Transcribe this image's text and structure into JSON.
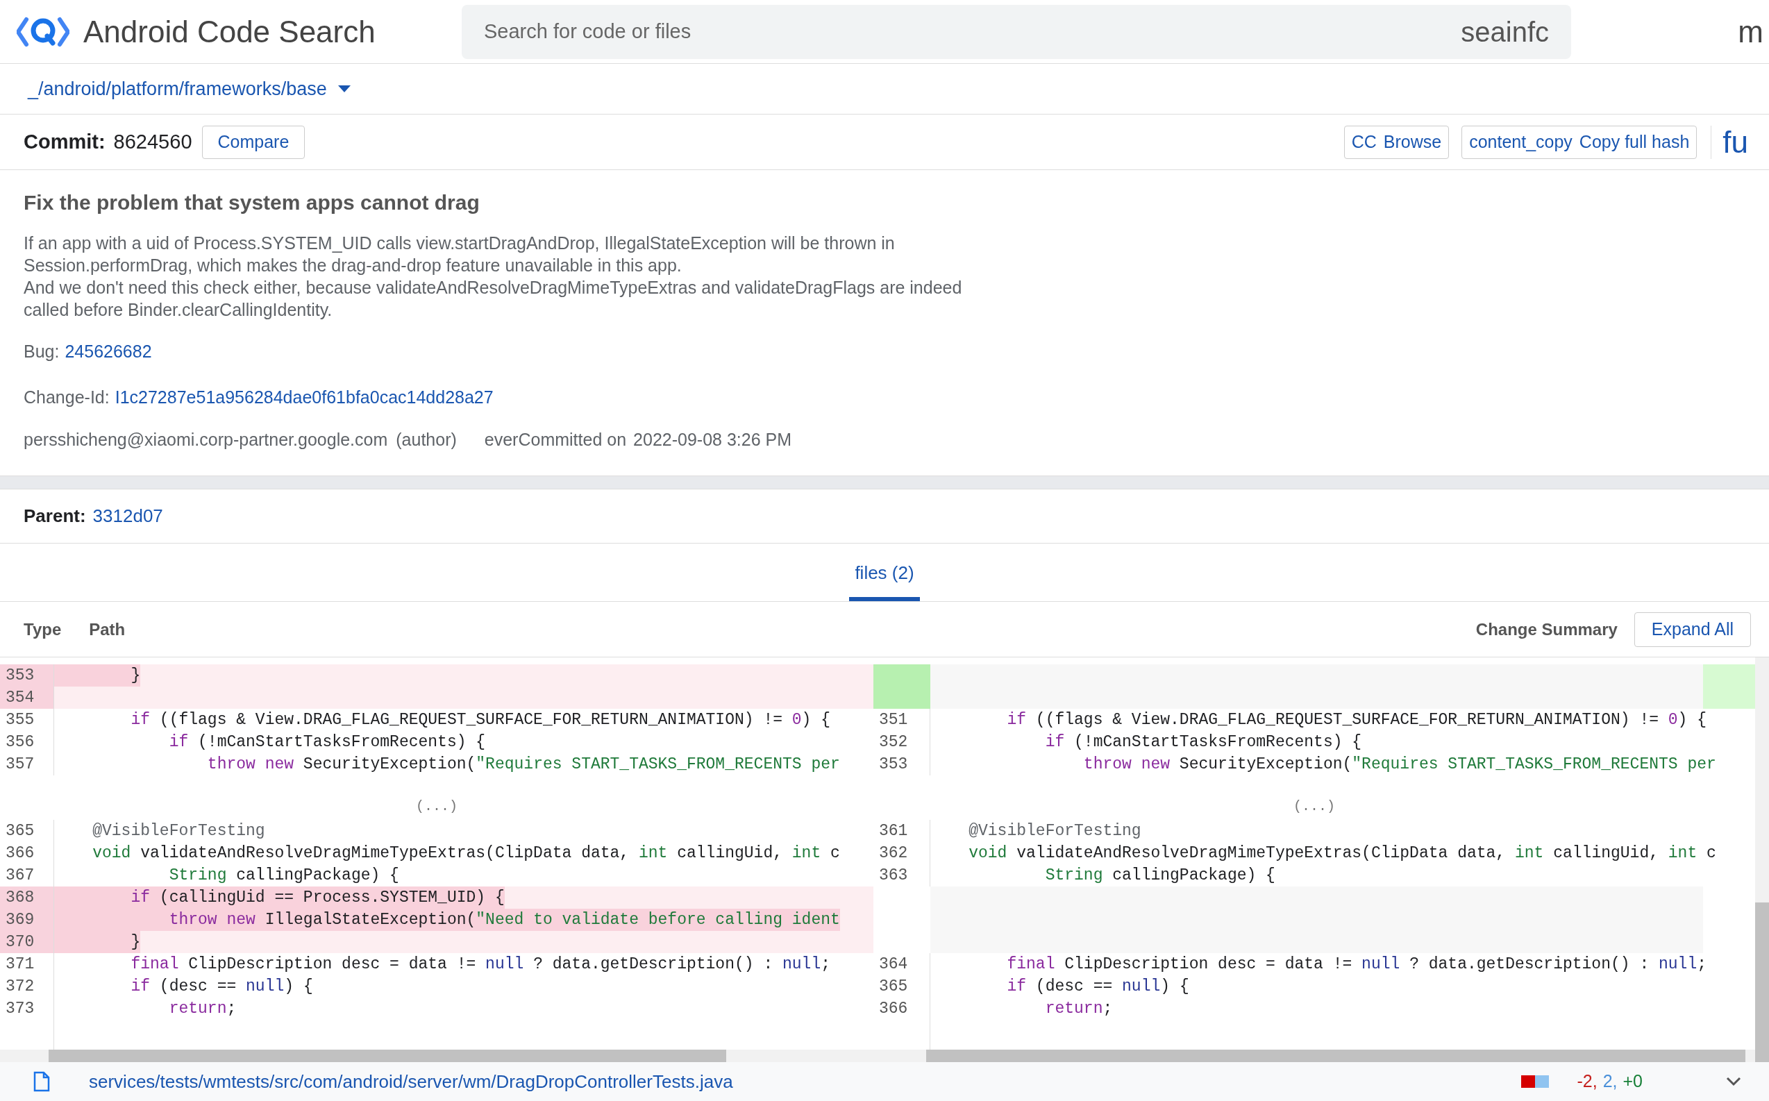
{
  "header": {
    "title": "Android Code Search",
    "search": {
      "placeholder": "Search for code or files",
      "value": "seainfc"
    },
    "cut_text": "m"
  },
  "path_bar": {
    "path": "_/android/platform/frameworks/base"
  },
  "commit_bar": {
    "label": "Commit:",
    "hash": "8624560",
    "compare": "Compare",
    "buttons": [
      {
        "icon_text": "CC",
        "label": "Browse"
      },
      {
        "icon_text": "content_copy",
        "label": "Copy full hash"
      }
    ],
    "cut_text": "fu"
  },
  "message": {
    "title": "Fix the problem that system apps cannot drag",
    "body_lines": [
      "If an app with a uid of Process.SYSTEM_UID calls view.startDragAndDrop, IllegalStateException will be thrown in",
      "Session.performDrag, which makes the drag-and-drop feature unavailable in this app.",
      "And we don't need this check either, because validateAndResolveDragMimeTypeExtras and validateDragFlags are indeed",
      "called before Binder.clearCallingIdentity."
    ],
    "bug": {
      "label": "Bug:",
      "value": "245626682"
    },
    "change_id": {
      "label": "Change-Id:",
      "value": "I1c27287e51a956284dae0f61bfa0cac14dd28a27"
    },
    "author": {
      "prefix": "pers",
      "email": "shicheng@xiaomi.corp-partner.google.com",
      "role": "(author)"
    },
    "committed": {
      "prefix": "ever",
      "label": "Committed on",
      "date": "2022-09-08 3:26 PM"
    }
  },
  "parent": {
    "label": "Parent:",
    "value": "3312d07"
  },
  "tabs": [
    {
      "label": "files (2)",
      "selected": true
    }
  ],
  "table_header": {
    "columns": [
      "Type",
      "Path"
    ],
    "change_summary": "Change Summary",
    "expand_button": "Expand All"
  },
  "diff": {
    "left": [
      {
        "kind": "removed",
        "num": "353",
        "tokens": [
          {
            "kind": "p",
            "text": "        }"
          }
        ]
      },
      {
        "kind": "removed",
        "num": "354"
      },
      {
        "kind": "context",
        "num": "355",
        "tokens": [
          {
            "kind": "kw",
            "text": "        if"
          },
          {
            "kind": "p",
            "text": " ((flags & View.DRAG_FLAG_REQUEST_SURFACE_FOR_RETURN_ANIMATION) != "
          },
          {
            "kind": "num",
            "text": "0"
          },
          {
            "kind": "p",
            "text": ") {"
          }
        ]
      },
      {
        "kind": "context",
        "num": "356",
        "tokens": [
          {
            "kind": "kw",
            "text": "            if"
          },
          {
            "kind": "p",
            "text": " (!mCanStartTasksFromRecents) {"
          }
        ]
      },
      {
        "kind": "context",
        "num": "357",
        "tokens": [
          {
            "kind": "kw",
            "text": "                throw new"
          },
          {
            "kind": "p",
            "text": " SecurityException("
          },
          {
            "kind": "str",
            "text": "\"Requires START_TASKS_FROM_RECENTS per"
          }
        ]
      },
      {
        "kind": "expander",
        "text": "(...)"
      },
      {
        "kind": "context",
        "num": "365",
        "tokens": [
          {
            "kind": "an",
            "text": "    @VisibleForTesting"
          }
        ]
      },
      {
        "kind": "context",
        "num": "366",
        "tokens": [
          {
            "kind": "ty",
            "text": "    void"
          },
          {
            "kind": "p",
            "text": " validateAndResolveDragMimeTypeExtras(ClipData data, "
          },
          {
            "kind": "ty",
            "text": "int"
          },
          {
            "kind": "p",
            "text": " callingUid, "
          },
          {
            "kind": "ty",
            "text": "int"
          },
          {
            "kind": "p",
            "text": " c"
          }
        ]
      },
      {
        "kind": "context",
        "num": "367",
        "tokens": [
          {
            "kind": "ty",
            "text": "            String"
          },
          {
            "kind": "p",
            "text": " callingPackage) {"
          }
        ]
      },
      {
        "kind": "removed",
        "num": "368",
        "tokens": [
          {
            "kind": "kw",
            "text": "        if"
          },
          {
            "kind": "p",
            "text": " (callingUid == Process.SYSTEM_UID) {"
          }
        ]
      },
      {
        "kind": "removed",
        "num": "369",
        "tokens": [
          {
            "kind": "kw",
            "text": "            throw new"
          },
          {
            "kind": "p",
            "text": " IllegalStateException("
          },
          {
            "kind": "str",
            "text": "\"Need to validate before calling ident"
          }
        ]
      },
      {
        "kind": "removed",
        "num": "370",
        "tokens": [
          {
            "kind": "p",
            "text": "        }"
          }
        ]
      },
      {
        "kind": "context",
        "num": "371",
        "tokens": [
          {
            "kind": "kw",
            "text": "        final"
          },
          {
            "kind": "p",
            "text": " ClipDescription desc = data != "
          },
          {
            "kind": "nl",
            "text": "null"
          },
          {
            "kind": "p",
            "text": " ? data.getDescription() : "
          },
          {
            "kind": "nl",
            "text": "null"
          },
          {
            "kind": "p",
            "text": ";"
          }
        ]
      },
      {
        "kind": "context",
        "num": "372",
        "tokens": [
          {
            "kind": "kw",
            "text": "        if"
          },
          {
            "kind": "p",
            "text": " (desc == "
          },
          {
            "kind": "nl",
            "text": "null"
          },
          {
            "kind": "p",
            "text": ") {"
          }
        ]
      },
      {
        "kind": "context",
        "num": "373",
        "tokens": [
          {
            "kind": "kw",
            "text": "            return"
          },
          {
            "kind": "p",
            "text": ";"
          }
        ]
      }
    ],
    "right": [
      {
        "kind": "added_filler"
      },
      {
        "kind": "added_filler"
      },
      {
        "kind": "context",
        "num": "351",
        "tokens": [
          {
            "kind": "kw",
            "text": "        if"
          },
          {
            "kind": "p",
            "text": " ((flags & View.DRAG_FLAG_REQUEST_SURFACE_FOR_RETURN_ANIMATION) != "
          },
          {
            "kind": "num",
            "text": "0"
          },
          {
            "kind": "p",
            "text": ") {"
          }
        ]
      },
      {
        "kind": "context",
        "num": "352",
        "tokens": [
          {
            "kind": "kw",
            "text": "            if"
          },
          {
            "kind": "p",
            "text": " (!mCanStartTasksFromRecents) {"
          }
        ]
      },
      {
        "kind": "context",
        "num": "353",
        "tokens": [
          {
            "kind": "kw",
            "text": "                throw new"
          },
          {
            "kind": "p",
            "text": " SecurityException("
          },
          {
            "kind": "str",
            "text": "\"Requires START_TASKS_FROM_RECENTS per"
          }
        ]
      },
      {
        "kind": "expander",
        "text": "(...)"
      },
      {
        "kind": "context",
        "num": "361",
        "tokens": [
          {
            "kind": "an",
            "text": "    @VisibleForTesting"
          }
        ]
      },
      {
        "kind": "context",
        "num": "362",
        "tokens": [
          {
            "kind": "ty",
            "text": "    void"
          },
          {
            "kind": "p",
            "text": " validateAndResolveDragMimeTypeExtras(ClipData data, "
          },
          {
            "kind": "ty",
            "text": "int"
          },
          {
            "kind": "p",
            "text": " callingUid, "
          },
          {
            "kind": "ty",
            "text": "int"
          },
          {
            "kind": "p",
            "text": " c"
          }
        ]
      },
      {
        "kind": "context",
        "num": "363",
        "tokens": [
          {
            "kind": "ty",
            "text": "            String"
          },
          {
            "kind": "p",
            "text": " callingPackage) {"
          }
        ]
      },
      {
        "kind": "filler"
      },
      {
        "kind": "filler"
      },
      {
        "kind": "filler"
      },
      {
        "kind": "context",
        "num": "364",
        "tokens": [
          {
            "kind": "kw",
            "text": "        final"
          },
          {
            "kind": "p",
            "text": " ClipDescription desc = data != "
          },
          {
            "kind": "nl",
            "text": "null"
          },
          {
            "kind": "p",
            "text": " ? data.getDescription() : "
          },
          {
            "kind": "nl",
            "text": "null"
          },
          {
            "kind": "p",
            "text": ";"
          }
        ]
      },
      {
        "kind": "context",
        "num": "365",
        "tokens": [
          {
            "kind": "kw",
            "text": "        if"
          },
          {
            "kind": "p",
            "text": " (desc == "
          },
          {
            "kind": "nl",
            "text": "null"
          },
          {
            "kind": "p",
            "text": ") {"
          }
        ]
      },
      {
        "kind": "context",
        "num": "366",
        "tokens": [
          {
            "kind": "kw",
            "text": "            return"
          },
          {
            "kind": "p",
            "text": ";"
          }
        ]
      }
    ]
  },
  "file": {
    "path": "services/tests/wmtests/src/com/android/server/wm/DragDropControllerTests.java",
    "stats": [
      {
        "kind": "removed",
        "text": "-2,"
      },
      {
        "kind": "changed",
        "text": "2,"
      },
      {
        "kind": "added",
        "text": "+0"
      }
    ]
  }
}
